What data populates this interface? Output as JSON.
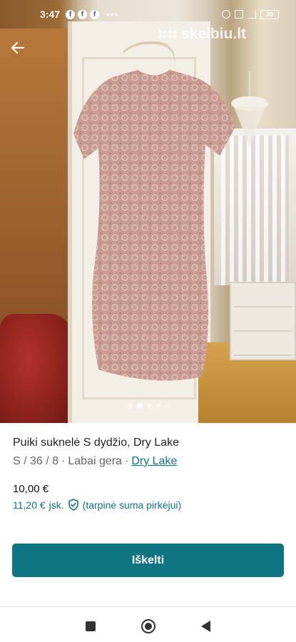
{
  "status_bar": {
    "time": "3:47",
    "battery": "30"
  },
  "watermark": {
    "text": "skelbiu.lt"
  },
  "gallery": {
    "page_count": 5,
    "active_index": 1
  },
  "listing": {
    "title": "Puiki suknelė S dydžio, Dry Lake",
    "size": "S / 36 / 8",
    "separator1": "·",
    "condition": "Labai gera",
    "separator2": "·",
    "brand": "Dry Lake",
    "price": "10,00 €",
    "price_total": "11,20 €",
    "price_total_suffix": "jsk.",
    "buyer_note": "(tarpinė suma pirkėjui)"
  },
  "actions": {
    "bump_label": "Iškelti"
  },
  "colors": {
    "accent": "#0f7582",
    "dress": "#c79b91"
  }
}
